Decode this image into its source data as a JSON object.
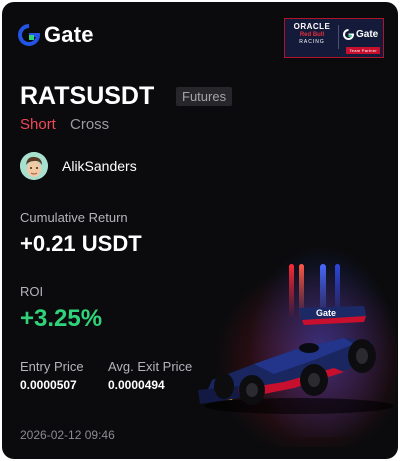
{
  "brand": {
    "name": "Gate",
    "icon": "gate-logo-icon",
    "accent_color": "#2354e6"
  },
  "sponsor": {
    "line1": "ORACLE",
    "line2": "Red Bull",
    "line3": "RACING",
    "brand": "Gate",
    "tag": "Team Partner"
  },
  "position": {
    "symbol": "RATSUSDT",
    "market_type": "Futures",
    "side": "Short",
    "margin_mode": "Cross",
    "side_color": "#f0475a"
  },
  "user": {
    "name": "AlikSanders",
    "avatar_icon": "avatar-icon"
  },
  "stats": {
    "cumulative_return_label": "Cumulative Return",
    "cumulative_return_value": "+0.21 USDT",
    "roi_label": "ROI",
    "roi_value": "+3.25%",
    "roi_color": "#2fd47a",
    "entry_price_label": "Entry Price",
    "entry_price_value": "0.0000507",
    "exit_price_label": "Avg. Exit Price",
    "exit_price_value": "0.0000494"
  },
  "timestamp": "2026-02-12 09:46",
  "artwork": {
    "car_livery": "Gate"
  }
}
